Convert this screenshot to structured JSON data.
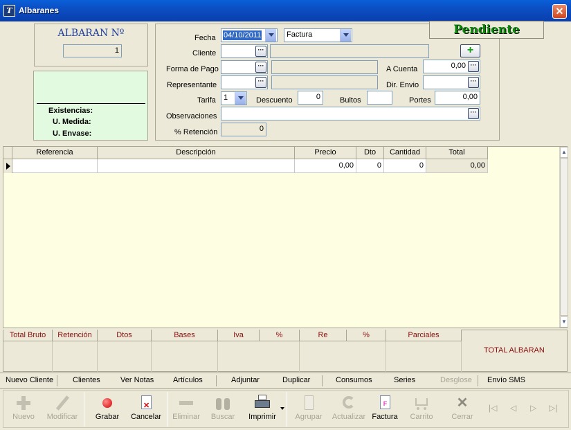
{
  "window": {
    "title": "Albaranes",
    "close": "✕",
    "app_icon": "T"
  },
  "header": {
    "albaran_label": "ALBARAN Nº",
    "albaran_number": "1",
    "status": "Pendiente",
    "stock": {
      "existencias": "Existencias:",
      "medida": "U. Medida:",
      "envase": "U. Envase:"
    }
  },
  "form": {
    "fecha_label": "Fecha",
    "fecha_value": "04/10/2011",
    "doc_type": "Factura",
    "cliente_label": "Cliente",
    "forma_pago_label": "Forma de Pago",
    "a_cuenta_label": "A Cuenta",
    "a_cuenta_value": "0,00",
    "representante_label": "Representante",
    "dir_envio_label": "Dir. Envio",
    "tarifa_label": "Tarifa",
    "tarifa_value": "1",
    "descuento_label": "Descuento",
    "descuento_value": "0",
    "bultos_label": "Bultos",
    "bultos_value": "",
    "portes_label": "Portes",
    "portes_value": "0,00",
    "observaciones_label": "Observaciones",
    "retencion_label": "% Retención",
    "retencion_value": "0",
    "dots": "···",
    "add": "+"
  },
  "grid": {
    "columns": [
      "Referencia",
      "Descripción",
      "Precio",
      "Dto",
      "Cantidad",
      "Total"
    ],
    "rows": [
      {
        "referencia": "",
        "descripcion": "",
        "precio": "0,00",
        "dto": "0",
        "cantidad": "0",
        "total": "0,00"
      }
    ]
  },
  "totals": {
    "columns": [
      "Total Bruto",
      "Retención",
      "Dtos",
      "Bases",
      "Iva",
      "%",
      "Re",
      "%",
      "Parciales"
    ],
    "total_albaran_label": "TOTAL ALBARAN"
  },
  "links": [
    "Nuevo Cliente",
    "Clientes",
    "Ver Notas",
    "Artículos",
    "Adjuntar",
    "Duplicar",
    "Consumos",
    "Series",
    "Desglose",
    "Envío SMS"
  ],
  "toolbar": {
    "nuevo": "Nuevo",
    "modificar": "Modificar",
    "grabar": "Grabar",
    "cancelar": "Cancelar",
    "eliminar": "Eliminar",
    "buscar": "Buscar",
    "imprimir": "Imprimir",
    "agrupar": "Agrupar",
    "actualizar": "Actualizar",
    "factura": "Factura",
    "carrito": "Carrito",
    "cerrar": "Cerrar"
  },
  "colors": {
    "status": "#0a8a0a",
    "title_blue": "#1f3fa0",
    "totals_red": "#8b1010"
  }
}
